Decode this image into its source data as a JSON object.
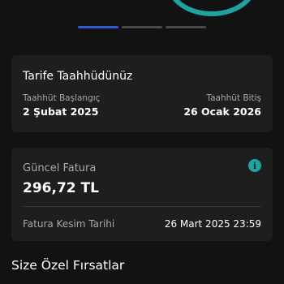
{
  "pager": {
    "total_pages": 3,
    "active_index": 0
  },
  "commitment": {
    "title": "Tarife Taahhüdünüz",
    "start_label": "Taahhüt Başlangıç",
    "start_value": "2 Şubat 2025",
    "end_label": "Taahhüt Bitiş",
    "end_value": "26 Ocak 2026"
  },
  "invoice": {
    "label": "Güncel Fatura",
    "amount": "296,72 TL",
    "info_icon": "info-icon",
    "cut_label": "Fatura Kesim Tarihi",
    "cut_value": "26 Mart 2025 23:59"
  },
  "offers": {
    "title": "Size Özel Fırsatlar"
  },
  "colors": {
    "background": "#121212",
    "card": "#1e1e1e",
    "accent_teal": "#1ea3a3",
    "pager_active": "#2f5bd3",
    "muted_text": "#a8a8a8"
  }
}
